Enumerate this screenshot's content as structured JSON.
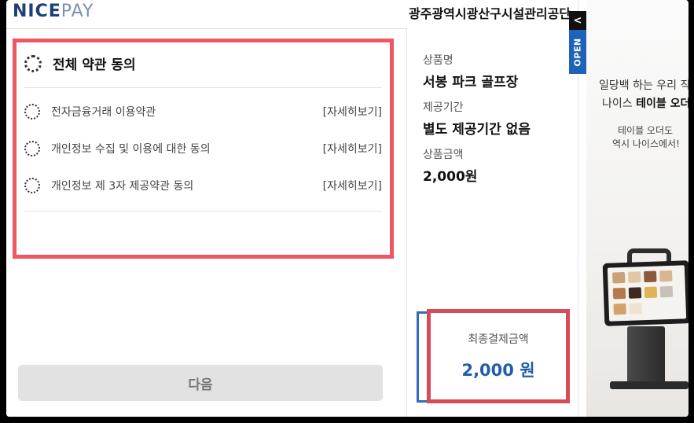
{
  "brand": {
    "part1": "NICE",
    "part2": "PAY"
  },
  "terms": {
    "all_label": "전체 약관 동의",
    "items": [
      {
        "label": "전자금융거래 이용약관",
        "link": "[자세히보기]"
      },
      {
        "label": "개인정보 수집 및 이용에 대한 동의",
        "link": "[자세히보기]"
      },
      {
        "label": "개인정보 제 3자 제공약관 동의",
        "link": "[자세히보기]"
      }
    ]
  },
  "next_button": "다음",
  "order": {
    "merchant": "광주광역시광산구시설관리공단",
    "product_label": "상품명",
    "product_value": "서봉 파크 골프장",
    "period_label": "제공기간",
    "period_value": "별도 제공기간 없음",
    "amount_label": "상품금액",
    "amount_value": "2,000원",
    "final_label": "최종결제금액",
    "final_amount": "2,000 원"
  },
  "tab": {
    "arrow": "<",
    "open": "OPEN"
  },
  "banner": {
    "line1": "일당백 하는 우리 직원",
    "line2_pre": "나이스 ",
    "line2_bold": "테이블 오더",
    "line3": "테이블 오더도",
    "line4": "역시 나이스에서!"
  },
  "colors": {
    "annotation_red": "#ef5663",
    "annotation_blue": "#2f6db5",
    "accent_blue": "#1f5ea8",
    "tab_blue": "#1e63b8"
  }
}
